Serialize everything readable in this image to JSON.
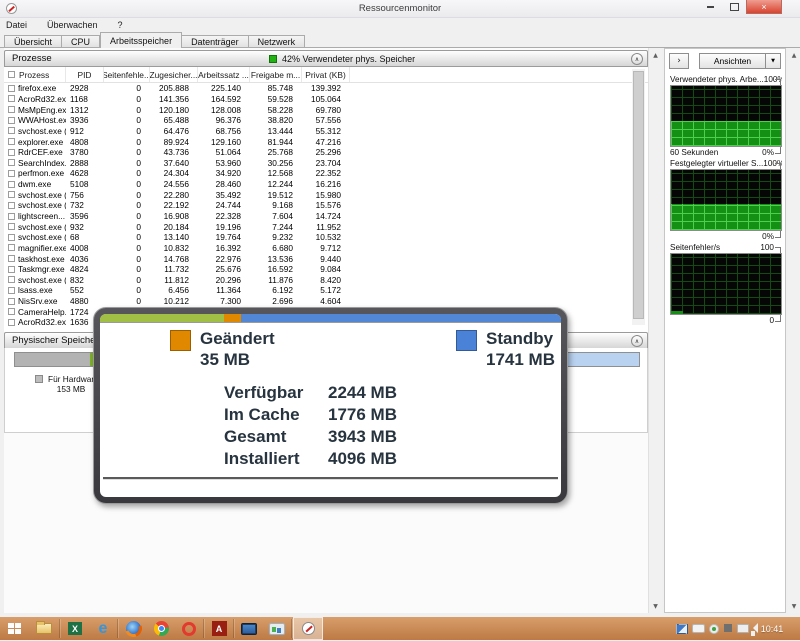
{
  "window": {
    "title": "Ressourcenmonitor"
  },
  "menu": {
    "items": [
      {
        "label": "Datei"
      },
      {
        "label": "Überwachen"
      },
      {
        "label": "?"
      }
    ]
  },
  "tabs": [
    {
      "label": "Übersicht",
      "active": false
    },
    {
      "label": "CPU",
      "active": false
    },
    {
      "label": "Arbeitsspeicher",
      "active": true
    },
    {
      "label": "Datenträger",
      "active": false
    },
    {
      "label": "Netzwerk",
      "active": false
    }
  ],
  "processes": {
    "title": "Prozesse",
    "status_text": "42% Verwendeter phys. Speicher",
    "status_color": "#23b214",
    "columns": [
      "Prozess",
      "PID",
      "Seitenfehle...",
      "Zugesicher...",
      "Arbeitssatz ...",
      "Freigabe m...",
      "Privat (KB)"
    ],
    "rows": [
      [
        "firefox.exe",
        "2928",
        "0",
        "205.888",
        "225.140",
        "85.748",
        "139.392"
      ],
      [
        "AcroRd32.exe",
        "1168",
        "0",
        "141.356",
        "164.592",
        "59.528",
        "105.064"
      ],
      [
        "MsMpEng.exe",
        "1312",
        "0",
        "120.180",
        "128.008",
        "58.228",
        "69.780"
      ],
      [
        "WWAHost.exe",
        "3936",
        "0",
        "65.488",
        "96.376",
        "38.820",
        "57.556"
      ],
      [
        "svchost.exe (...",
        "912",
        "0",
        "64.476",
        "68.756",
        "13.444",
        "55.312"
      ],
      [
        "explorer.exe",
        "4808",
        "0",
        "89.924",
        "129.160",
        "81.944",
        "47.216"
      ],
      [
        "RdrCEF.exe",
        "3780",
        "0",
        "43.736",
        "51.064",
        "25.768",
        "25.296"
      ],
      [
        "SearchIndex...",
        "2888",
        "0",
        "37.640",
        "53.960",
        "30.256",
        "23.704"
      ],
      [
        "perfmon.exe",
        "4628",
        "0",
        "24.304",
        "34.920",
        "12.568",
        "22.352"
      ],
      [
        "dwm.exe",
        "5108",
        "0",
        "24.556",
        "28.460",
        "12.244",
        "16.216"
      ],
      [
        "svchost.exe (...",
        "756",
        "0",
        "22.280",
        "35.492",
        "19.512",
        "15.980"
      ],
      [
        "svchost.exe (...",
        "732",
        "0",
        "22.192",
        "24.744",
        "9.168",
        "15.576"
      ],
      [
        "lightscreen...",
        "3596",
        "0",
        "16.908",
        "22.328",
        "7.604",
        "14.724"
      ],
      [
        "svchost.exe (...",
        "932",
        "0",
        "20.184",
        "19.196",
        "7.244",
        "11.952"
      ],
      [
        "svchost.exe (...",
        "68",
        "0",
        "13.140",
        "19.764",
        "9.232",
        "10.532"
      ],
      [
        "magnifier.exe",
        "4008",
        "0",
        "10.832",
        "16.392",
        "6.680",
        "9.712"
      ],
      [
        "taskhost.exe",
        "4036",
        "0",
        "14.768",
        "22.976",
        "13.536",
        "9.440"
      ],
      [
        "Taskmgr.exe",
        "4824",
        "0",
        "11.732",
        "25.676",
        "16.592",
        "9.084"
      ],
      [
        "svchost.exe (...",
        "832",
        "0",
        "11.812",
        "20.296",
        "11.876",
        "8.420"
      ],
      [
        "lsass.exe",
        "552",
        "0",
        "6.456",
        "11.364",
        "6.192",
        "5.172"
      ],
      [
        "NisSrv.exe",
        "4880",
        "0",
        "10.212",
        "7.300",
        "2.696",
        "4.604"
      ],
      [
        "CameraHelp...",
        "1724",
        "",
        "",
        "",
        "",
        ""
      ],
      [
        "AcroRd32.exe",
        "1636",
        "",
        "",
        "",
        "",
        ""
      ]
    ]
  },
  "physical_memory": {
    "title": "Physischer Speicher",
    "hardware_legend_label": "Für Hardwar",
    "hardware_legend_value": "153 MB",
    "bar_segments": [
      {
        "name": "hardware-reserved",
        "color": "#b3b3b3",
        "pct": 12
      },
      {
        "name": "in-use",
        "color": "#7cb226",
        "pct": 30
      },
      {
        "name": "modified",
        "color": "#e08800",
        "pct": 3
      },
      {
        "name": "standby",
        "color": "#5187d5",
        "pct": 42
      },
      {
        "name": "free",
        "color": "#b9d2f0",
        "pct": 13
      }
    ]
  },
  "magnifier": {
    "bar_segments": [
      {
        "name": "in-use",
        "color": "#a0bf44",
        "pct": 27
      },
      {
        "name": "modified",
        "color": "#e08800",
        "pct": 3.5
      },
      {
        "name": "standby",
        "color": "#5187d5",
        "pct": 69.5
      }
    ],
    "legend": [
      {
        "label": "Geändert",
        "value": "35 MB",
        "color": "#e08800"
      },
      {
        "label": "Standby",
        "value": "1741 MB",
        "color": "#4a82d8"
      }
    ],
    "stats": [
      {
        "label": "Verfügbar",
        "value": "2244 MB"
      },
      {
        "label": "Im Cache",
        "value": "1776 MB"
      },
      {
        "label": "Gesamt",
        "value": "3943 MB"
      },
      {
        "label": "Installiert",
        "value": "4096 MB"
      }
    ]
  },
  "sidebar": {
    "views_label": "Ansichten",
    "graphs": [
      {
        "title": "Verwendeter phys. Arbe...",
        "max_label": "100%",
        "min_label": "0%",
        "x_label": "60 Sekunden",
        "fill_pct": 42
      },
      {
        "title": "Festgelegter virtueller S...",
        "max_label": "100%",
        "min_label": "0%",
        "x_label": "",
        "fill_pct": 44
      },
      {
        "title": "Seitenfehler/s",
        "max_label": "100",
        "min_label": "0",
        "x_label": "",
        "fill_pct": 0
      }
    ]
  },
  "taskbar": {
    "time": "10:41"
  }
}
